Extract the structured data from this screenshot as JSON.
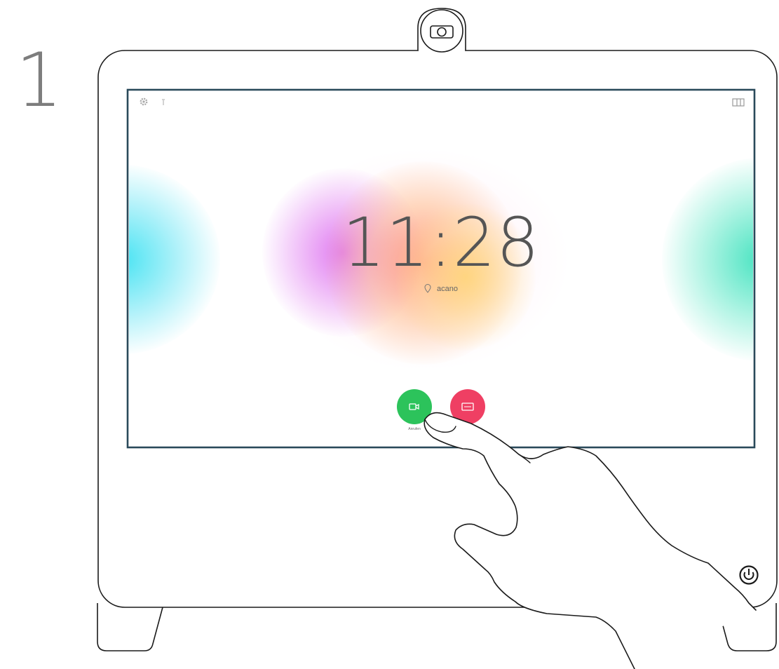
{
  "step": {
    "number": "1"
  },
  "screen": {
    "time": "11:28",
    "location": "acano",
    "call_button_label": "Anrufen"
  },
  "icons": {
    "camera": "camera-lens-icon",
    "settings": "gear-icon",
    "info": "info-icon",
    "layout": "layout-icon",
    "location": "location-pin-icon",
    "call": "video-camera-icon",
    "share": "screen-share-icon",
    "power": "power-icon",
    "hand": "pointing-hand"
  },
  "colors": {
    "call_button": "#2cc35b",
    "share_button": "#ef3f63",
    "outline": "#1a1a1a",
    "screen_border": "#2a4a5a"
  }
}
